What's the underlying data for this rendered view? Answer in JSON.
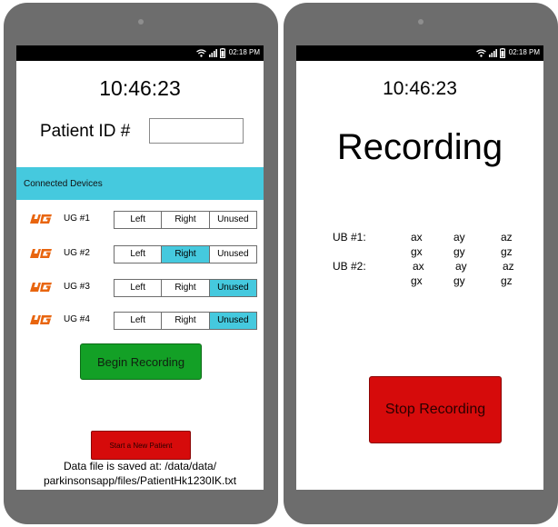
{
  "status_bar": {
    "time": "02:18 PM"
  },
  "left_screen": {
    "clock": "10:46:23",
    "patient_id_label": "Patient ID #",
    "patient_id_value": "",
    "devices_header": "Connected Devices",
    "segment_labels": [
      "Left",
      "Right",
      "Unused"
    ],
    "devices": [
      {
        "name": "UG #1",
        "selected": ""
      },
      {
        "name": "UG #2",
        "selected": "Right"
      },
      {
        "name": "UG #3",
        "selected": "Unused"
      },
      {
        "name": "UG #4",
        "selected": "Unused"
      }
    ],
    "begin_button": "Begin Recording",
    "new_patient_button": "Start a New Patient",
    "save_line1": "Data file is saved at: /data/data/",
    "save_line2": "parkinsonsapp/files/PatientHk1230IK.txt"
  },
  "right_screen": {
    "clock": "10:46:23",
    "title": "Recording",
    "ub1_label": "UB #1:",
    "ub2_label": "UB #2:",
    "ub1_row1": [
      "ax",
      "ay",
      "az"
    ],
    "ub1_row2": [
      "gx",
      "gy",
      "gz"
    ],
    "ub2_row1": [
      "ax",
      "ay",
      "az"
    ],
    "ub2_row2": [
      "gx",
      "gy",
      "gz"
    ],
    "stop_button": "Stop Recording"
  },
  "colors": {
    "accent": "#45c9de",
    "begin": "#13a026",
    "stop": "#d60b0b",
    "logo": "#e8650f"
  }
}
